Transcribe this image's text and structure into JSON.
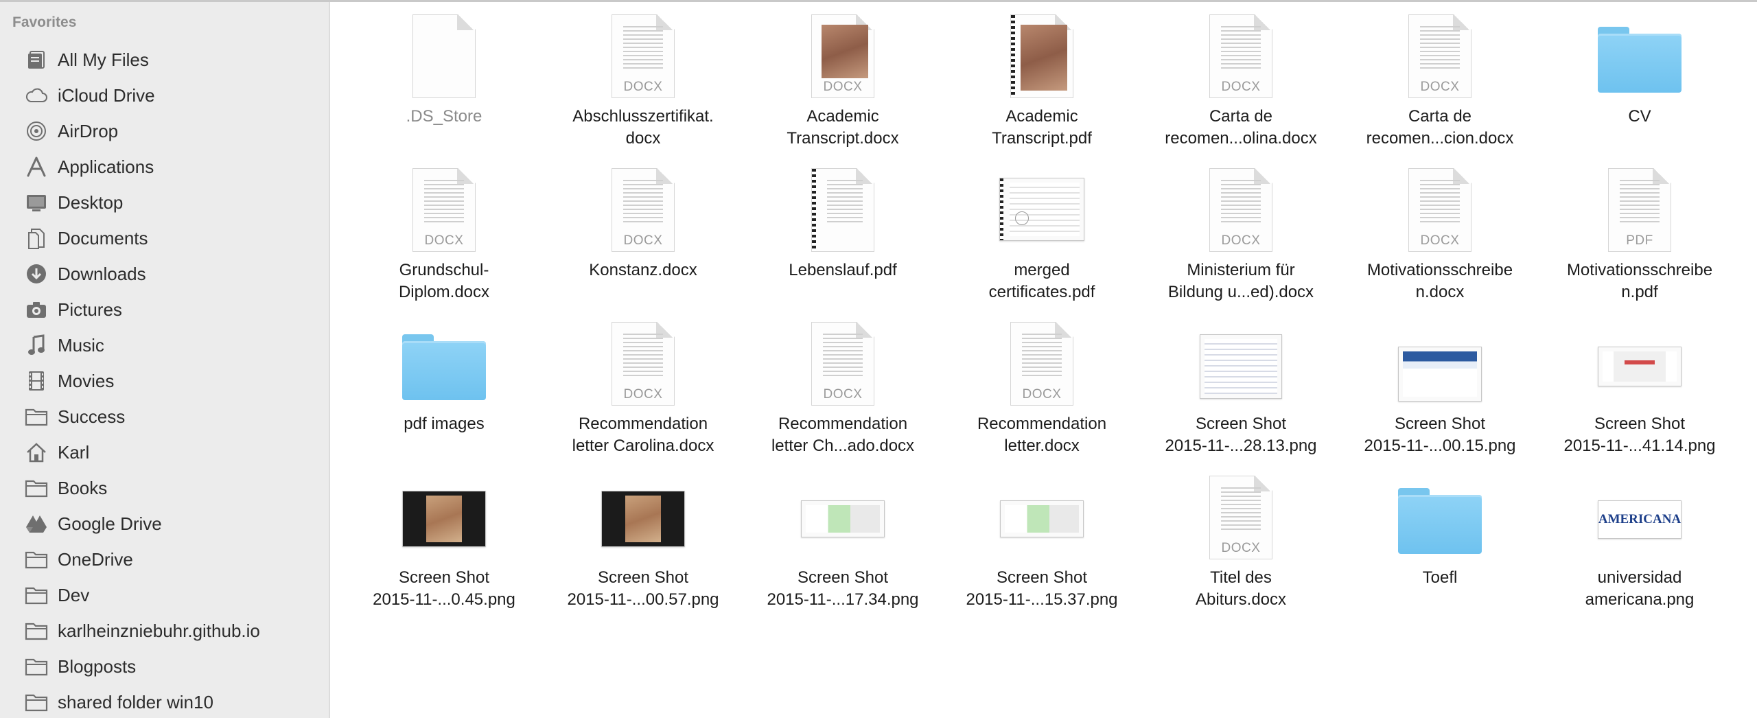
{
  "sidebar": {
    "header": "Favorites",
    "items": [
      {
        "label": "All My Files",
        "icon": "all-files-icon"
      },
      {
        "label": "iCloud Drive",
        "icon": "cloud-icon"
      },
      {
        "label": "AirDrop",
        "icon": "airdrop-icon"
      },
      {
        "label": "Applications",
        "icon": "applications-icon"
      },
      {
        "label": "Desktop",
        "icon": "desktop-icon"
      },
      {
        "label": "Documents",
        "icon": "documents-icon"
      },
      {
        "label": "Downloads",
        "icon": "downloads-icon"
      },
      {
        "label": "Pictures",
        "icon": "camera-icon"
      },
      {
        "label": "Music",
        "icon": "music-note-icon"
      },
      {
        "label": "Movies",
        "icon": "film-icon"
      },
      {
        "label": "Success",
        "icon": "folder-icon"
      },
      {
        "label": "Karl",
        "icon": "home-icon"
      },
      {
        "label": "Books",
        "icon": "folder-icon"
      },
      {
        "label": "Google Drive",
        "icon": "google-drive-icon"
      },
      {
        "label": "OneDrive",
        "icon": "folder-icon"
      },
      {
        "label": "Dev",
        "icon": "folder-icon"
      },
      {
        "label": "karlheinzniebuhr.github.io",
        "icon": "folder-icon"
      },
      {
        "label": "Blogposts",
        "icon": "folder-icon"
      },
      {
        "label": "shared folder win10",
        "icon": "folder-icon"
      }
    ]
  },
  "files": [
    {
      "name": ".DS_Store",
      "kind": "blank",
      "dim": true
    },
    {
      "name": "Abschlusszertifikat.\ndocx",
      "kind": "doc",
      "type": "DOCX"
    },
    {
      "name": "Academic\nTranscript.docx",
      "kind": "photo-doc",
      "type": "DOCX"
    },
    {
      "name": "Academic\nTranscript.pdf",
      "kind": "photo-pdf",
      "type": ""
    },
    {
      "name": "Carta de\nrecomen...olina.docx",
      "kind": "doc",
      "type": "DOCX"
    },
    {
      "name": "Carta de\nrecomen...cion.docx",
      "kind": "doc",
      "type": "DOCX"
    },
    {
      "name": "CV",
      "kind": "folder"
    },
    {
      "name": "Grundschul-\nDiplom.docx",
      "kind": "doc",
      "type": "DOCX"
    },
    {
      "name": "Konstanz.docx",
      "kind": "doc",
      "type": "DOCX"
    },
    {
      "name": "Lebenslauf.pdf",
      "kind": "pdf-bound",
      "type": ""
    },
    {
      "name": "merged\ncertificates.pdf",
      "kind": "landscape-pdf",
      "type": ""
    },
    {
      "name": "Ministerium für\nBildung u...ed).docx",
      "kind": "doc",
      "type": "DOCX"
    },
    {
      "name": "Motivationsschreibe\nn.docx",
      "kind": "doc",
      "type": "DOCX"
    },
    {
      "name": "Motivationsschreibe\nn.pdf",
      "kind": "doc",
      "type": "PDF"
    },
    {
      "name": "pdf images",
      "kind": "folder"
    },
    {
      "name": "Recommendation\nletter Carolina.docx",
      "kind": "doc",
      "type": "DOCX"
    },
    {
      "name": "Recommendation\nletter Ch...ado.docx",
      "kind": "doc",
      "type": "DOCX"
    },
    {
      "name": "Recommendation\nletter.docx",
      "kind": "doc",
      "type": "DOCX"
    },
    {
      "name": "Screen Shot\n2015-11-...28.13.png",
      "kind": "shot-form"
    },
    {
      "name": "Screen Shot\n2015-11-...00.15.png",
      "kind": "shot-web"
    },
    {
      "name": "Screen Shot\n2015-11-...41.14.png",
      "kind": "shot-dialog"
    },
    {
      "name": "Screen Shot\n2015-11-...0.45.png",
      "kind": "shot-photo"
    },
    {
      "name": "Screen Shot\n2015-11-...00.57.png",
      "kind": "shot-photo"
    },
    {
      "name": "Screen Shot\n2015-11-...17.34.png",
      "kind": "shot-green"
    },
    {
      "name": "Screen Shot\n2015-11-...15.37.png",
      "kind": "shot-green"
    },
    {
      "name": "Titel des\nAbiturs.docx",
      "kind": "doc",
      "type": "DOCX"
    },
    {
      "name": "Toefl",
      "kind": "folder"
    },
    {
      "name": "universidad\namericana.png",
      "kind": "logo",
      "logo_text": "AMERICANA"
    }
  ],
  "colors": {
    "folder": "#7cc9f0",
    "sidebar_bg": "#ececec",
    "sidebar_icon": "#6f6f6f"
  }
}
